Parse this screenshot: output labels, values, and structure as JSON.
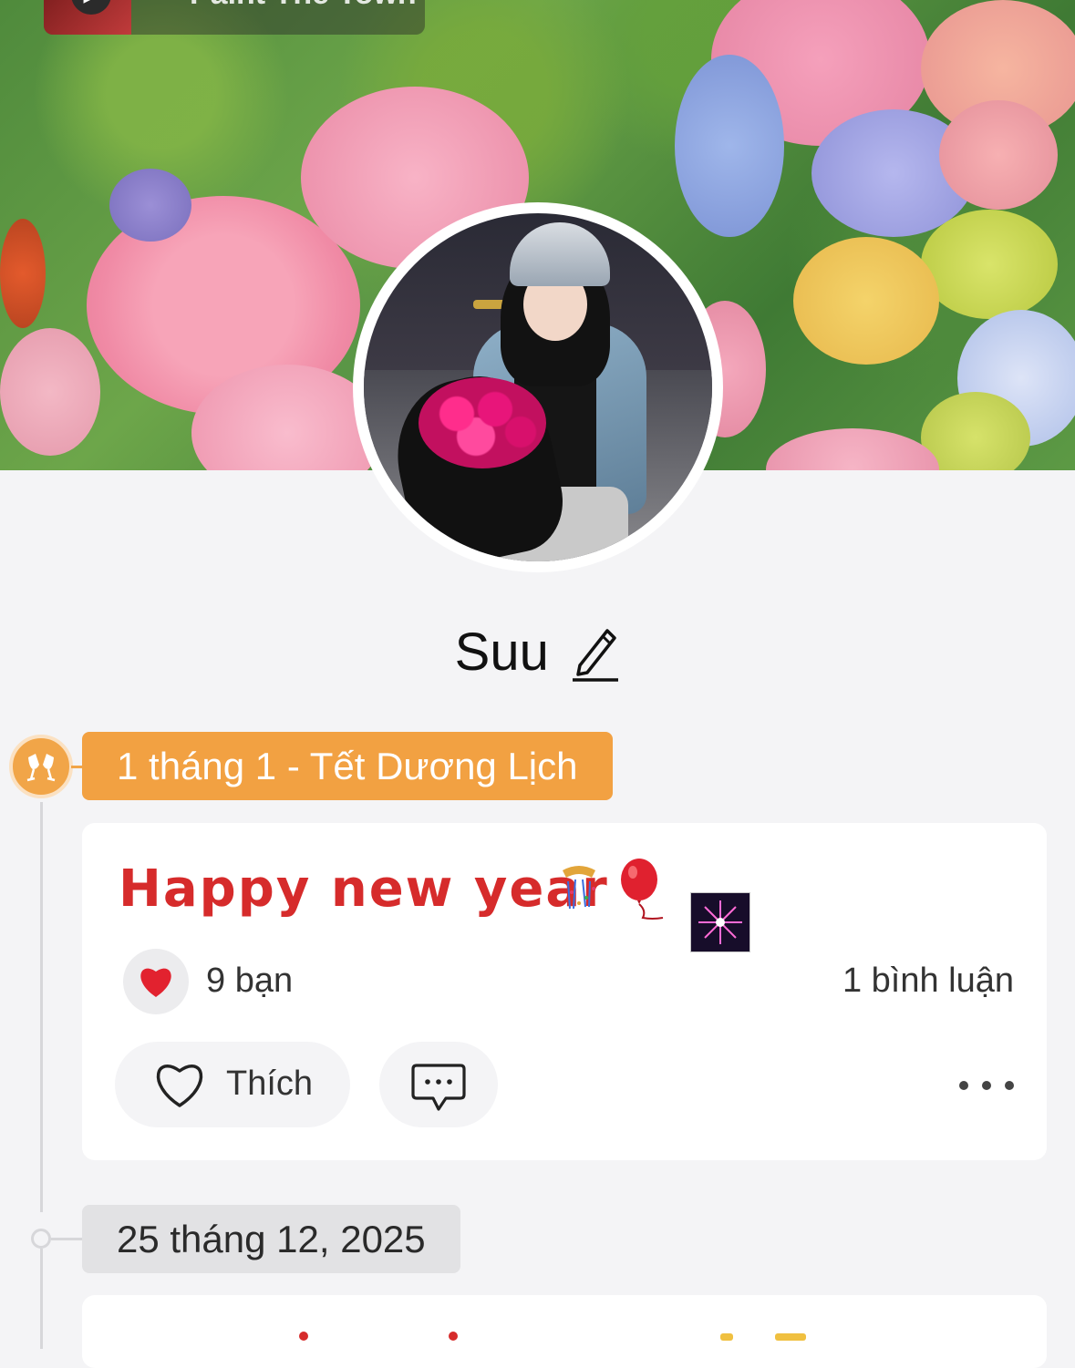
{
  "cover": {
    "music_title": "Paint The Town"
  },
  "profile": {
    "name": "Suu"
  },
  "timeline": {
    "event": {
      "label": "1 tháng 1 - Tết Dương Lịch",
      "icon": "cheers-icon",
      "color": "#f2a142"
    },
    "post": {
      "text": "Happy new year",
      "emojis": [
        "confetti-icon",
        "balloon-icon",
        "fireworks-icon"
      ],
      "text_color": "#d62b2b",
      "reactions": {
        "icon": "heart-icon",
        "count_label": "9 bạn"
      },
      "comments_label": "1 bình luận",
      "actions": {
        "like_label": "Thích"
      }
    },
    "next_date": {
      "label": "25 tháng 12, 2025"
    }
  }
}
